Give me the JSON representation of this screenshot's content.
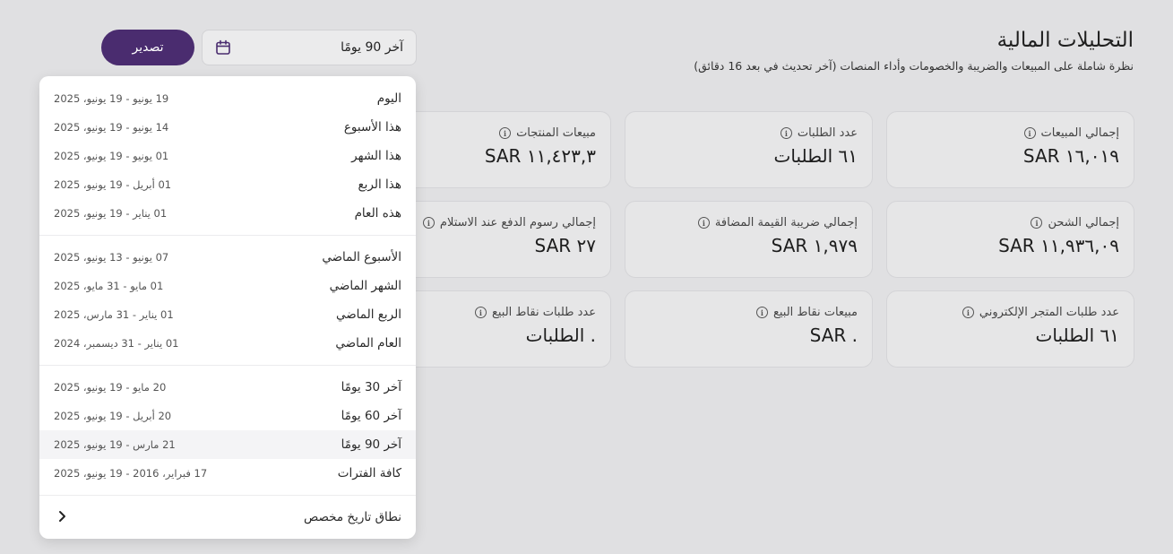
{
  "header": {
    "title": "التحليلات المالية",
    "subtitle": "نظرة شاملة على المبيعات والضريبة والخصومات وأداء المنصات (آخر تحديث في بعد 16 دقائق)"
  },
  "toolbar": {
    "export_label": "تصدير",
    "date_range_value": "آخر 90 يومًا"
  },
  "cards": [
    {
      "label": "إجمالي المبيعات",
      "value": "١٦,٠١٩ SAR"
    },
    {
      "label": "عدد الطلبات",
      "value": "٦١ الطلبات"
    },
    {
      "label": "مبيعات المنتجات",
      "value": "١١,٤٢٣,٣ SAR"
    },
    {
      "label": "إجمالي الشحن",
      "value": "١١,٩٣٦,٠٩ SAR"
    },
    {
      "label": "إجمالي ضريبة القيمة المضافة",
      "value": "١,٩٧٩ SAR"
    },
    {
      "label": "إجمالي رسوم الدفع عند الاستلام",
      "value": "٢٧ SAR"
    },
    {
      "label": "عدد طلبات المتجر الإلكتروني",
      "value": "٦١ الطلبات"
    },
    {
      "label": "مبيعات نقاط البيع",
      "value": ". SAR"
    },
    {
      "label": "عدد طلبات نقاط البيع",
      "value": ". الطلبات"
    }
  ],
  "dropdown": {
    "options": [
      {
        "name": "اليوم",
        "range": "19 يونيو - 19 يونيو، 2025"
      },
      {
        "name": "هذا الأسبوع",
        "range": "14 يونيو - 19 يونيو، 2025"
      },
      {
        "name": "هذا الشهر",
        "range": "01 يونيو - 19 يونيو، 2025"
      },
      {
        "name": "هذا الربع",
        "range": "01 أبريل - 19 يونيو، 2025"
      },
      {
        "name": "هذه العام",
        "range": "01 يناير - 19 يونيو، 2025"
      },
      {
        "name": "الأسبوع الماضي",
        "range": "07 يونيو - 13 يونيو، 2025"
      },
      {
        "name": "الشهر الماضي",
        "range": "01 مايو - 31 مايو، 2025"
      },
      {
        "name": "الربع الماضي",
        "range": "01 يناير - 31 مارس، 2025"
      },
      {
        "name": "العام الماضي",
        "range": "01 يناير - 31 ديسمبر، 2024"
      },
      {
        "name": "آخر 30 يومًا",
        "range": "20 مايو - 19 يونيو، 2025"
      },
      {
        "name": "آخر 60 يومًا",
        "range": "20 أبريل - 19 يونيو، 2025"
      },
      {
        "name": "آخر 90 يومًا",
        "range": "21 مارس - 19 يونيو، 2025"
      },
      {
        "name": "كافة الفترات",
        "range": "17 فبراير، 2016 - 19 يونيو، 2025"
      }
    ],
    "selected_option": "آخر 90 يومًا",
    "custom_label": "نطاق تاريخ مخصص"
  },
  "colors": {
    "accent": "#4a2c6f",
    "background": "#e0e0e2",
    "card": "#e6e6e7"
  }
}
